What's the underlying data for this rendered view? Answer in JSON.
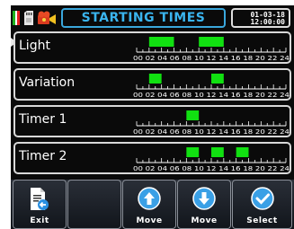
{
  "header": {
    "title": "STARTING TIMES",
    "date": "01-03-18",
    "time": "12:00:00"
  },
  "colors": {
    "accent": "#3ab4ee",
    "active_segment": "#11e011",
    "background": "#0a0a0a"
  },
  "timeline": {
    "hour_labels": "00 02 04 06 08 10 12 14 16 18 20 22 24"
  },
  "rows": [
    {
      "label": "Light",
      "active_hours": [
        [
          2,
          6
        ],
        [
          10,
          14
        ]
      ]
    },
    {
      "label": "Variation",
      "active_hours": [
        [
          2,
          4
        ],
        [
          12,
          14
        ]
      ]
    },
    {
      "label": "Timer 1",
      "active_hours": [
        [
          8,
          10
        ]
      ]
    },
    {
      "label": "Timer 2",
      "active_hours": [
        [
          8,
          10
        ],
        [
          12,
          14
        ],
        [
          16,
          18
        ]
      ]
    }
  ],
  "toolbar": {
    "exit_label": "Exit",
    "move_up_label": "Move",
    "move_down_label": "Move",
    "select_label": "Select"
  },
  "icons": [
    "italy-flag-icon",
    "sd-card-icon",
    "film-camera-icon",
    "exit-document-icon",
    "arrow-up-circle-icon",
    "arrow-down-circle-icon",
    "checkmark-circle-icon"
  ]
}
